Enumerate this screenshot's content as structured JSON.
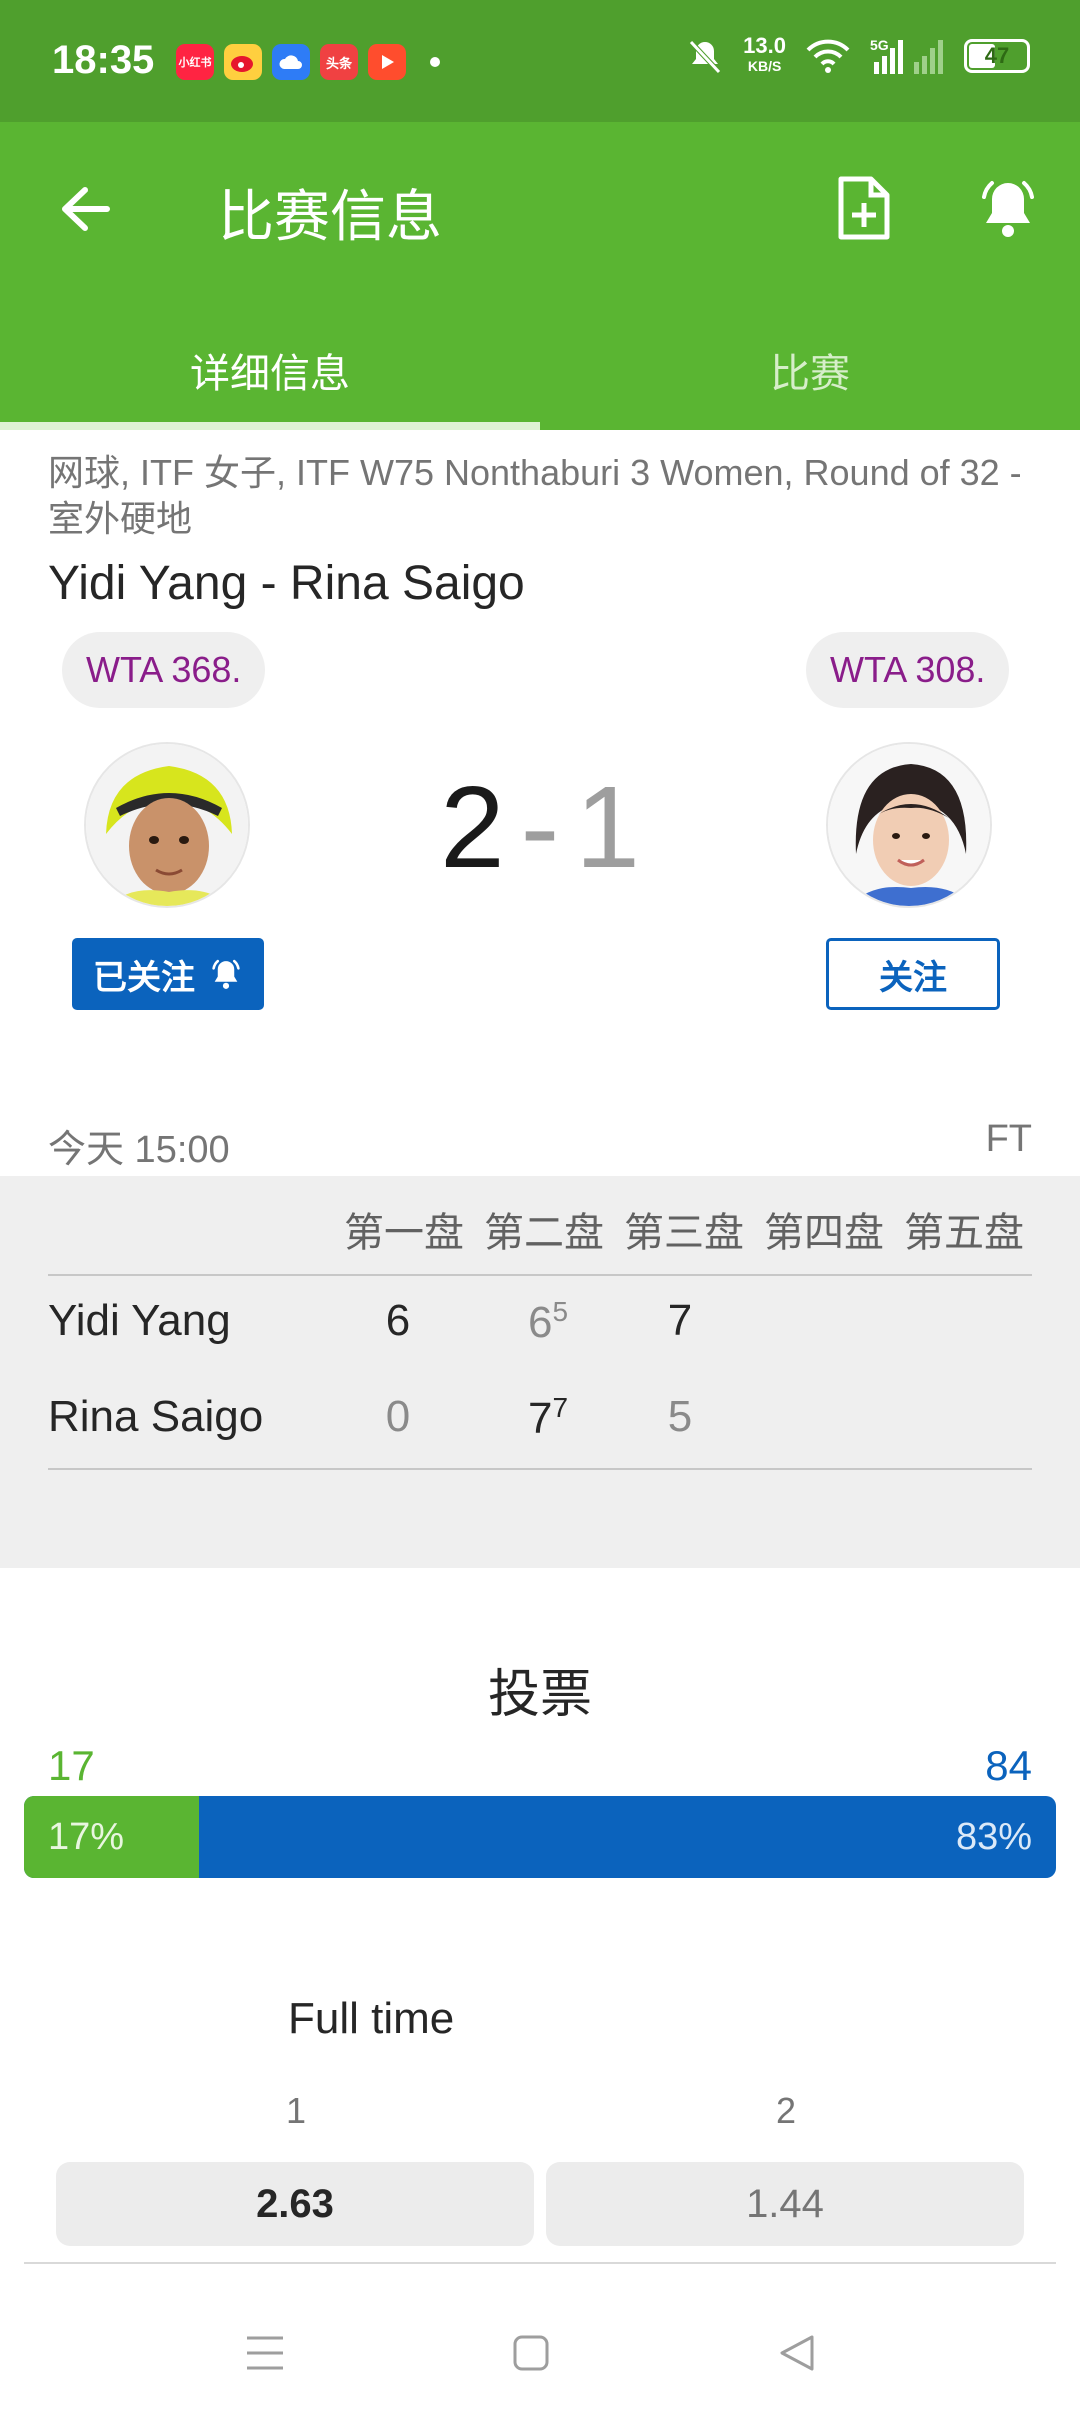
{
  "status_bar": {
    "time": "18:35",
    "apps": [
      "小红书",
      "weibo",
      "cloud",
      "头条",
      "video"
    ],
    "net_speed": "13.0",
    "net_unit": "KB/S",
    "signal": "5G",
    "battery": "47"
  },
  "appbar": {
    "title": "比赛信息",
    "tabs": [
      "详细信息",
      "比赛"
    ]
  },
  "match": {
    "tournament": "网球, ITF 女子, ITF W75 Nonthaburi 3 Women, Round of 32 - 室外硬地",
    "title": "Yidi Yang - Rina Saigo",
    "player1": {
      "name": "Yidi Yang",
      "rank": "WTA 368.",
      "follow": "已关注"
    },
    "player2": {
      "name": "Rina Saigo",
      "rank": "WTA 308.",
      "follow": "关注"
    },
    "score_home": "2",
    "score_sep": "-",
    "score_away": "1",
    "time": "今天 15:00",
    "status": "FT"
  },
  "sets": {
    "headers": [
      "第一盘",
      "第二盘",
      "第三盘",
      "第四盘",
      "第五盘"
    ],
    "rows": [
      {
        "name": "Yidi Yang",
        "s1": "6",
        "s2": "6",
        "s2_tb": "5",
        "s3": "7"
      },
      {
        "name": "Rina Saigo",
        "s1": "0",
        "s2": "7",
        "s2_tb": "7",
        "s3": "5"
      }
    ]
  },
  "votes": {
    "title": "投票",
    "count1": "17",
    "count2": "84",
    "pct1_label": "17%",
    "pct2_label": "83%",
    "pct1": 17,
    "colors": {
      "home": "#5ab532",
      "away": "#0b63bd"
    }
  },
  "odds": {
    "title": "Full time",
    "labels": [
      "1",
      "2"
    ],
    "values": [
      "2.63",
      "1.44"
    ]
  }
}
